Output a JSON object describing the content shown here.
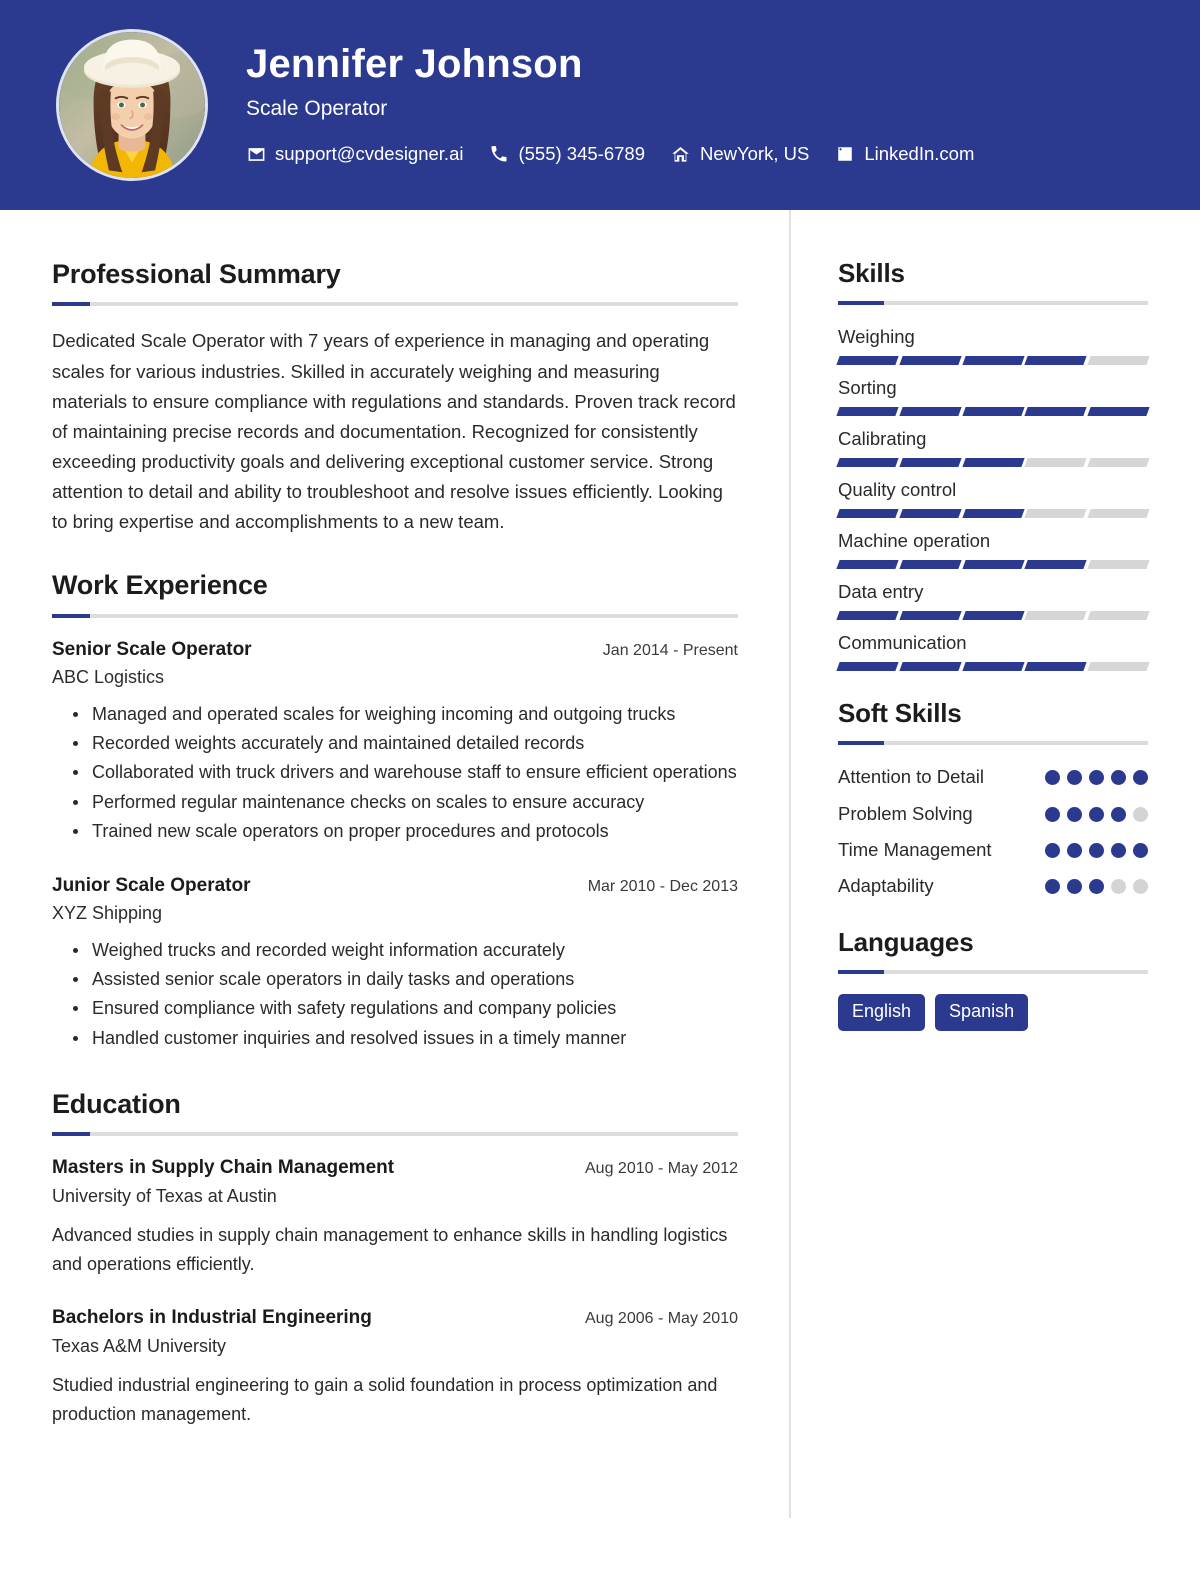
{
  "theme": {
    "primary": "#2B3A8F",
    "rule_gray": "#dcdcdc",
    "divider_gray": "#e2e2e5",
    "segment_off": "#d6d6d6",
    "dot_off": "#d4d4d4"
  },
  "header": {
    "name": "Jennifer Johnson",
    "role": "Scale Operator",
    "avatar_alt": "profile-photo",
    "contacts": [
      {
        "icon": "envelope-icon",
        "text": "support@cvdesigner.ai"
      },
      {
        "icon": "phone-icon",
        "text": "(555) 345-6789"
      },
      {
        "icon": "home-icon",
        "text": "NewYork, US"
      },
      {
        "icon": "linkedin-icon",
        "text": "LinkedIn.com"
      }
    ]
  },
  "main": {
    "summary": {
      "title": "Professional Summary",
      "text": "Dedicated Scale Operator with 7 years of experience in managing and operating scales for various industries. Skilled in accurately weighing and measuring materials to ensure compliance with regulations and standards. Proven track record of maintaining precise records and documentation. Recognized for consistently exceeding productivity goals and delivering exceptional customer service. Strong attention to detail and ability to troubleshoot and resolve issues efficiently. Looking to bring expertise and accomplishments to a new team."
    },
    "experience": {
      "title": "Work Experience",
      "entries": [
        {
          "title": "Senior Scale Operator",
          "date": "Jan 2014 - Present",
          "org": "ABC Logistics",
          "bullets": [
            "Managed and operated scales for weighing incoming and outgoing trucks",
            "Recorded weights accurately and maintained detailed records",
            "Collaborated with truck drivers and warehouse staff to ensure efficient operations",
            "Performed regular maintenance checks on scales to ensure accuracy",
            "Trained new scale operators on proper procedures and protocols"
          ]
        },
        {
          "title": "Junior Scale Operator",
          "date": "Mar 2010 - Dec 2013",
          "org": "XYZ Shipping",
          "bullets": [
            "Weighed trucks and recorded weight information accurately",
            "Assisted senior scale operators in daily tasks and operations",
            "Ensured compliance with safety regulations and company policies",
            "Handled customer inquiries and resolved issues in a timely manner"
          ]
        }
      ]
    },
    "education": {
      "title": "Education",
      "entries": [
        {
          "title": "Masters in Supply Chain Management",
          "date": "Aug 2010 - May 2012",
          "org": "University of Texas at Austin",
          "desc": "Advanced studies in supply chain management to enhance skills in handling logistics and operations efficiently."
        },
        {
          "title": "Bachelors in Industrial Engineering",
          "date": "Aug 2006 - May 2010",
          "org": "Texas A&M University",
          "desc": "Studied industrial engineering to gain a solid foundation in process optimization and production management."
        }
      ]
    }
  },
  "sidebar": {
    "skills": {
      "title": "Skills",
      "max": 5,
      "items": [
        {
          "label": "Weighing",
          "level": 4
        },
        {
          "label": "Sorting",
          "level": 5
        },
        {
          "label": "Calibrating",
          "level": 3
        },
        {
          "label": "Quality control",
          "level": 3
        },
        {
          "label": "Machine operation",
          "level": 4
        },
        {
          "label": "Data entry",
          "level": 3
        },
        {
          "label": "Communication",
          "level": 4
        }
      ]
    },
    "soft_skills": {
      "title": "Soft Skills",
      "max": 5,
      "items": [
        {
          "label": "Attention to Detail",
          "level": 5
        },
        {
          "label": "Problem Solving",
          "level": 4
        },
        {
          "label": "Time Management",
          "level": 5
        },
        {
          "label": "Adaptability",
          "level": 3
        }
      ]
    },
    "languages": {
      "title": "Languages",
      "items": [
        "English",
        "Spanish"
      ]
    }
  }
}
